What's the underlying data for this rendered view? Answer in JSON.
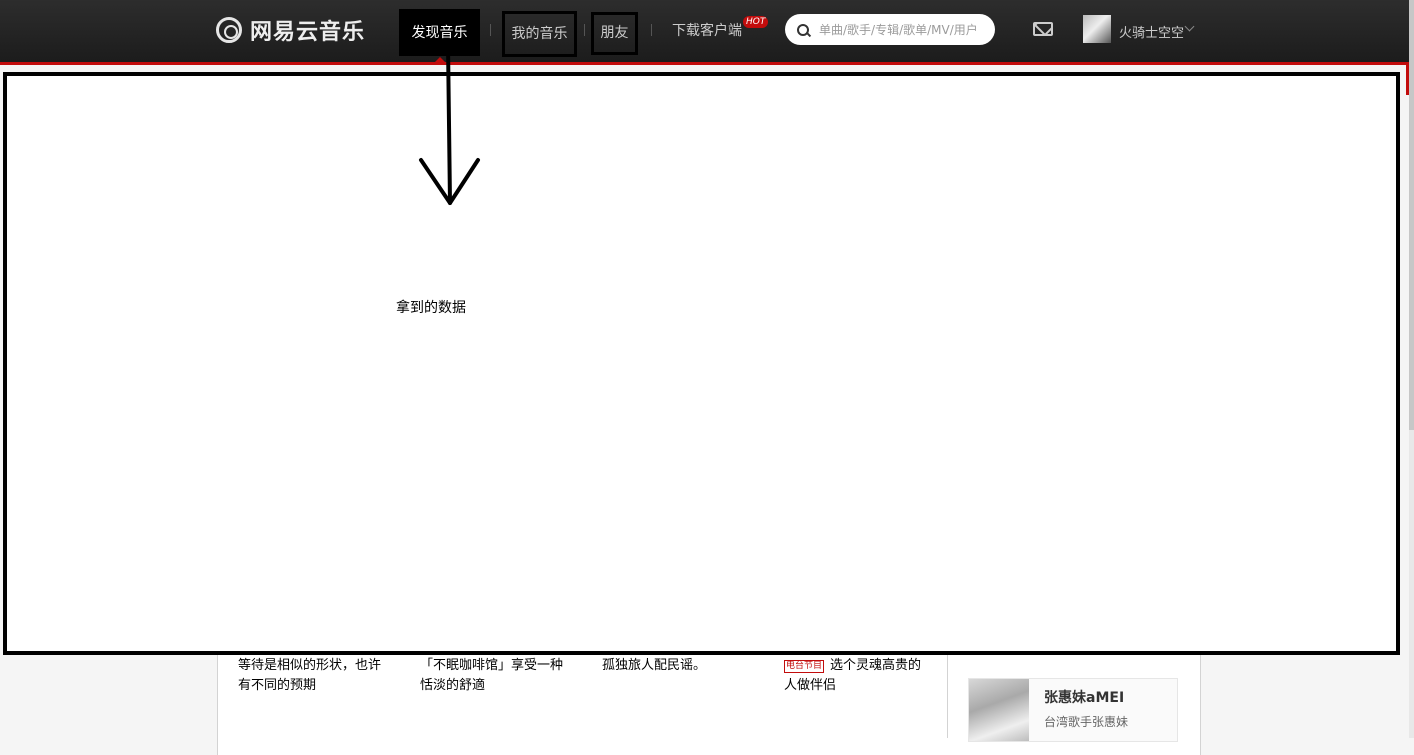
{
  "nav": {
    "logo_text": "网易云音乐",
    "discover": "发现音乐",
    "my_music": "我的音乐",
    "friends": "朋友",
    "download": "下载客户端",
    "hot_badge": "HOT",
    "search_placeholder": "单曲/歌手/专辑/歌单/MV/用户",
    "username": "火骑士空空"
  },
  "annotation": {
    "label": "拿到的数据"
  },
  "albums": [
    {
      "desc": "等待是相似的形状，也许有不同的预期"
    },
    {
      "desc": "「不眠咖啡馆」享受一种恬淡的舒適"
    },
    {
      "desc": "孤独旅人配民谣。"
    },
    {
      "tag": "电台节目",
      "desc": "选个灵魂高贵的人做伴侣"
    }
  ],
  "artist": {
    "name": "张惠妹aMEI",
    "desc": "台湾歌手张惠妹"
  },
  "colors": {
    "accent": "#c20c0c",
    "topbar": "#242424"
  }
}
